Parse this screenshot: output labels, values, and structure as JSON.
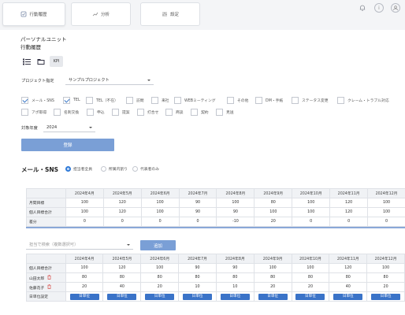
{
  "tabs": [
    {
      "label": "行動履歴",
      "icon": "history-icon"
    },
    {
      "label": "分析",
      "icon": "chart-icon"
    },
    {
      "label": "設定",
      "icon": "sliders-icon"
    }
  ],
  "header_icons": [
    "bell-icon",
    "info-icon",
    "user-icon"
  ],
  "breadcrumb": {
    "line1": "パーソナルユニット",
    "line2": "行動履歴"
  },
  "view_buttons": {
    "list": "list-icon",
    "folder": "folder-icon",
    "kpi": "KPI"
  },
  "project": {
    "label": "プロジェクト指定",
    "value": "サンプルプロジェクト"
  },
  "checkboxes": [
    {
      "label": "メール・SNS",
      "checked": true
    },
    {
      "label": "TEL",
      "checked": true
    },
    {
      "label": "TEL（不在）",
      "checked": false
    },
    {
      "label": "訪問",
      "checked": false
    },
    {
      "label": "来社",
      "checked": false
    },
    {
      "label": "WEBミーティング",
      "checked": false
    },
    {
      "label": "その他",
      "checked": false
    },
    {
      "label": "DM・手紙",
      "checked": false
    },
    {
      "label": "ステータス変更",
      "checked": false
    },
    {
      "label": "クレーム・トラブル対応",
      "checked": false
    },
    {
      "label": "アポ取得",
      "checked": false
    },
    {
      "label": "名刺交換",
      "checked": false
    },
    {
      "label": "申込",
      "checked": false
    },
    {
      "label": "提案",
      "checked": false
    },
    {
      "label": "打合せ",
      "checked": false
    },
    {
      "label": "商談",
      "checked": false
    },
    {
      "label": "契約",
      "checked": false
    },
    {
      "label": "見送",
      "checked": false
    }
  ],
  "year": {
    "label": "対象年度",
    "value": "2024"
  },
  "register_label": "登録",
  "section": {
    "title": "メール・SNS",
    "radios": [
      {
        "label": "担当者全員",
        "selected": true
      },
      {
        "label": "所属内割り",
        "selected": false
      },
      {
        "label": "代表者のみ",
        "selected": false
      }
    ]
  },
  "months": [
    "2024年4月",
    "2024年5月",
    "2024年6月",
    "2024年7月",
    "2024年8月",
    "2024年9月",
    "2024年10月",
    "2024年11月",
    "2024年12月"
  ],
  "table1": {
    "rows": [
      {
        "label": "月間目標",
        "values": [
          "100",
          "120",
          "100",
          "90",
          "100",
          "80",
          "100",
          "120",
          "100"
        ]
      },
      {
        "label": "個人目標合計",
        "values": [
          "100",
          "120",
          "100",
          "90",
          "90",
          "100",
          "100",
          "120",
          "100"
        ]
      },
      {
        "label": "差分",
        "values": [
          "0",
          "0",
          "0",
          "0",
          "-10",
          "20",
          "0",
          "0",
          "0"
        ]
      }
    ]
  },
  "assign": {
    "placeholder": "担当で検索（複数選択可）",
    "add_label": "追加"
  },
  "table2": {
    "rows": [
      {
        "label": "個人目標合計",
        "values": [
          "100",
          "120",
          "100",
          "90",
          "90",
          "100",
          "100",
          "120",
          "100"
        ],
        "deletable": false
      },
      {
        "label": "山田太郎",
        "values": [
          "80",
          "80",
          "80",
          "80",
          "80",
          "80",
          "80",
          "80",
          "80"
        ],
        "deletable": true
      },
      {
        "label": "佐藤花子",
        "values": [
          "20",
          "40",
          "20",
          "10",
          "10",
          "20",
          "20",
          "40",
          "20"
        ],
        "deletable": true
      }
    ],
    "footer_label": "日単位設定",
    "footer_button": "日単位"
  },
  "colors": {
    "accent": "#3a73c8",
    "button": "#7a9fd6",
    "checkmark": "#3a78c8",
    "delete": "#d9534f"
  }
}
